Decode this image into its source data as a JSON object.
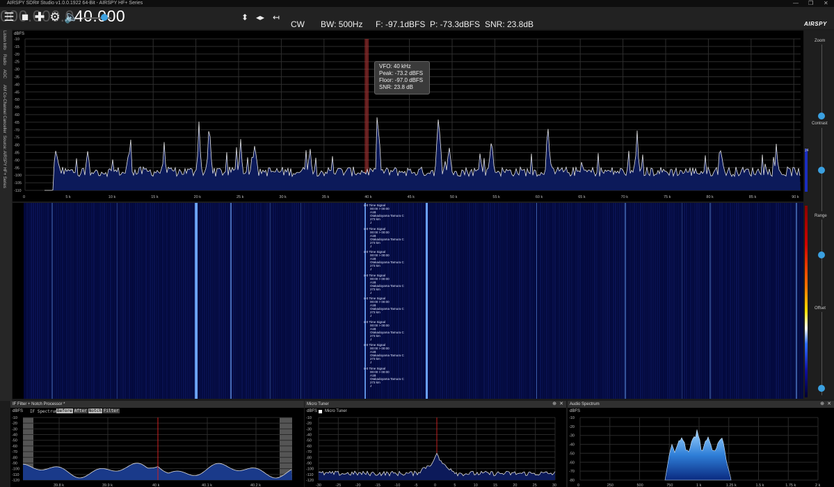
{
  "window": {
    "title": "AIRSPY SDR# Studio v1.0.0.1922 64-Bit - AIRSPY HF+ Series",
    "min": "—",
    "max": "❐",
    "close": "✕"
  },
  "toolbar": {
    "freq_dim": "000.000.0",
    "freq_bright": "40.000",
    "mode": "CW",
    "bandwidth": "BW: 500Hz",
    "floor": "F: -97.1dBFS",
    "peak": "P: -73.3dBFS",
    "snr": "SNR: 23.8dB",
    "logo": "AIRSPY",
    "volume": 0.7
  },
  "side_tabs": [
    "Listen Info",
    "Radio",
    "AGC",
    "AM Co-Channel Canceller",
    "Source: AIRSPY HF+ Series"
  ],
  "spectrum": {
    "y_unit": "dBFS",
    "y_ticks": [
      "-10",
      "-15",
      "-20",
      "-25",
      "-30",
      "-35",
      "-40",
      "-45",
      "-50",
      "-55",
      "-60",
      "-65",
      "-70",
      "-75",
      "-80",
      "-85",
      "-90",
      "-95",
      "-100",
      "-105",
      "-110"
    ],
    "x_ticks": [
      "0",
      "5 k",
      "10 k",
      "15 k",
      "20 k",
      "25 k",
      "30 k",
      "35 k",
      "40 k",
      "45 k",
      "50 k",
      "55 k",
      "60 k",
      "65 k",
      "70 k",
      "75 k",
      "80 k",
      "85 k",
      "90 k"
    ],
    "side_value": "24"
  },
  "tooltip": {
    "vfo": "VFO:  40 kHz",
    "peak": "Peak:  -73.2 dBFS",
    "floor": "Floor:  -97.0 dBFS",
    "snr": "SNR:  23.8 dB"
  },
  "waterfall": {
    "label_lines": [
      "Time Signal",
      "00:00 > 00:00",
      "A1B",
      "Otakadoyama Tamura C",
      "273 km",
      "J"
    ],
    "tag": "⊳0",
    "label_count": 8
  },
  "right_panel": {
    "zoom": "Zoom",
    "contrast": "Contrast",
    "range": "Range",
    "offset": "Offset"
  },
  "if_panel": {
    "title": "IF Filter + Notch Processor *",
    "y_unit": "dBFS",
    "spectrum_label": "IF Spectrum:",
    "chips": [
      "Before",
      "After",
      "Notch",
      "Filter"
    ],
    "y_ticks": [
      "-10",
      "-20",
      "-30",
      "-40",
      "-50",
      "-60",
      "-70",
      "-80",
      "-90",
      "-100",
      "-110",
      "-120"
    ],
    "x_ticks": [
      "39.8 k",
      "39.9 k",
      "40 k",
      "40.1 k",
      "40.2 k"
    ]
  },
  "micro_tuner": {
    "title": "Micro Tuner",
    "y_unit": "dBFS",
    "checkbox_label": "Micro Tuner",
    "y_ticks": [
      "-10",
      "-20",
      "-30",
      "-40",
      "-50",
      "-60",
      "-70",
      "-80",
      "-90",
      "-100",
      "-110",
      "-120"
    ],
    "x_ticks": [
      "-30",
      "-25",
      "-20",
      "-15",
      "-10",
      "-5",
      "0",
      "5",
      "10",
      "15",
      "20",
      "25",
      "30"
    ]
  },
  "audio_spectrum": {
    "title": "Audio Spectrum",
    "y_unit": "dBFS",
    "y_ticks": [
      "-10",
      "-20",
      "-30",
      "-40",
      "-50",
      "-60",
      "-70",
      "-80"
    ],
    "x_ticks": [
      "0",
      "250",
      "500",
      "750",
      "1 k",
      "1.25 k",
      "1.5 k",
      "1.75 k",
      "2 k"
    ]
  },
  "colors": {
    "accent": "#3aa0e0",
    "spectrum_line": "#e6e6e6",
    "spectrum_fill": "#0c1a5a",
    "vfo_marker": "#b03030",
    "waterfall_bg": "#03083a"
  }
}
